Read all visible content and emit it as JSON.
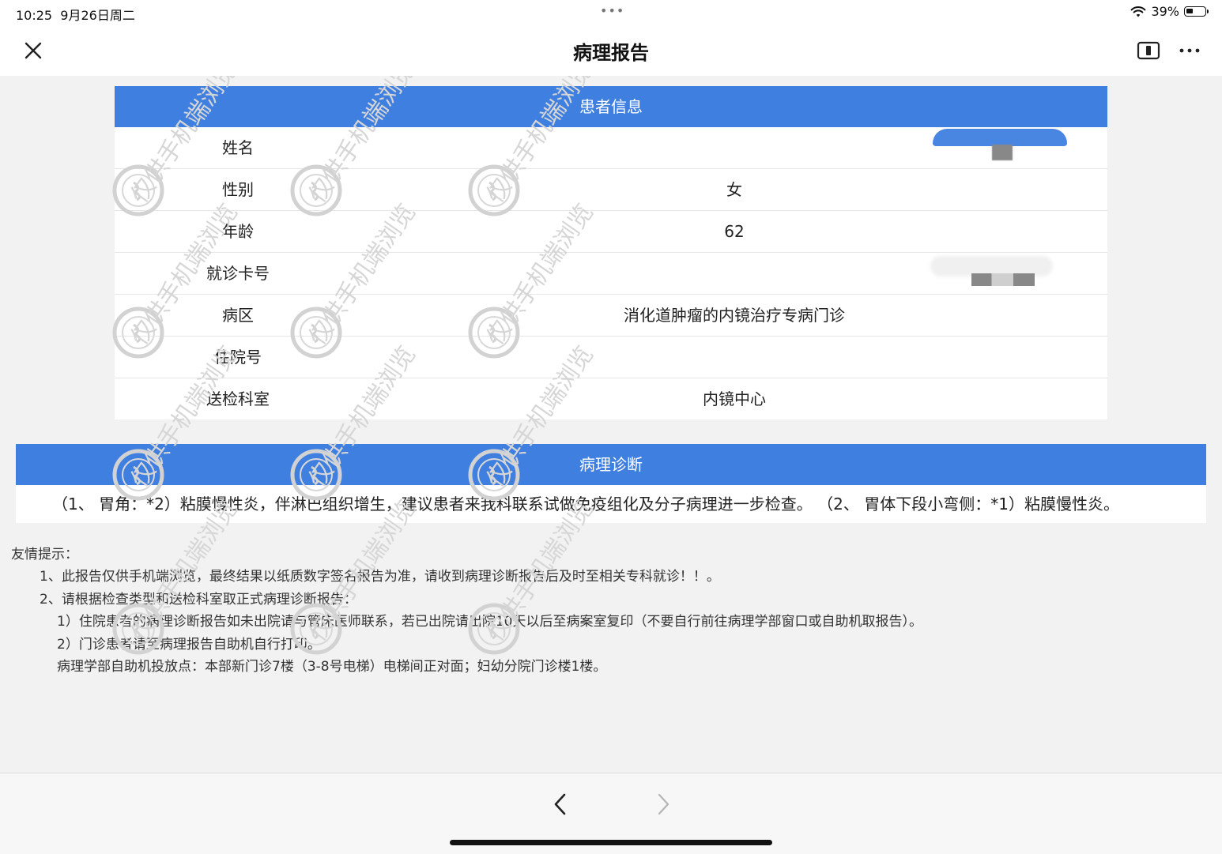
{
  "status_bar": {
    "time": "10:25",
    "date": "9月26日周二",
    "dots": "•••",
    "battery_percent": "39%",
    "battery_level": 0.39
  },
  "nav": {
    "title": "病理报告",
    "close_icon": "close-icon",
    "split_icon": "split-view-icon",
    "more_icon": "more-icon"
  },
  "patient_info": {
    "header": "患者信息",
    "rows": [
      {
        "label": "姓名",
        "value": ""
      },
      {
        "label": "性别",
        "value": "女"
      },
      {
        "label": "年龄",
        "value": "62"
      },
      {
        "label": "就诊卡号",
        "value": ""
      },
      {
        "label": "病区",
        "value": "消化道肿瘤的内镜治疗专病门诊"
      },
      {
        "label": "住院号",
        "value": ""
      },
      {
        "label": "送检科室",
        "value": "内镜中心"
      }
    ]
  },
  "diagnosis": {
    "header": "病理诊断",
    "text": "（1、 胃角：*2）粘膜慢性炎，伴淋巴组织增生，建议患者来我科联系试做免疫组化及分子病理进一步检查。 （2、 胃体下段小弯侧：*1）粘膜慢性炎。"
  },
  "tips": {
    "title": "友情提示：",
    "lines": [
      "1、此报告仅供手机端浏览，最终结果以纸质数字签名报告为准，请收到病理诊断报告后及时至相关专科就诊！！。",
      "2、请根据检查类型和送检科室取正式病理诊断报告：",
      "1）住院患者的病理诊断报告如未出院请与管床医师联系，若已出院请出院10天以后至病案室复印（不要自行前往病理学部窗口或自助机取报告）。",
      "2）门诊患者请至病理报告自助机自行打印。",
      "病理学部自助机投放点：本部新门诊7楼（3-8号电梯）电梯间正对面；妇幼分院门诊楼1楼。"
    ]
  },
  "watermark": {
    "text": "仅供手机端浏览"
  },
  "bottom_bar": {
    "back_icon": "chevron-left-icon",
    "forward_icon": "chevron-right-icon"
  },
  "colors": {
    "header_blue": "#3f7fe0",
    "background": "#f2f2f2"
  }
}
